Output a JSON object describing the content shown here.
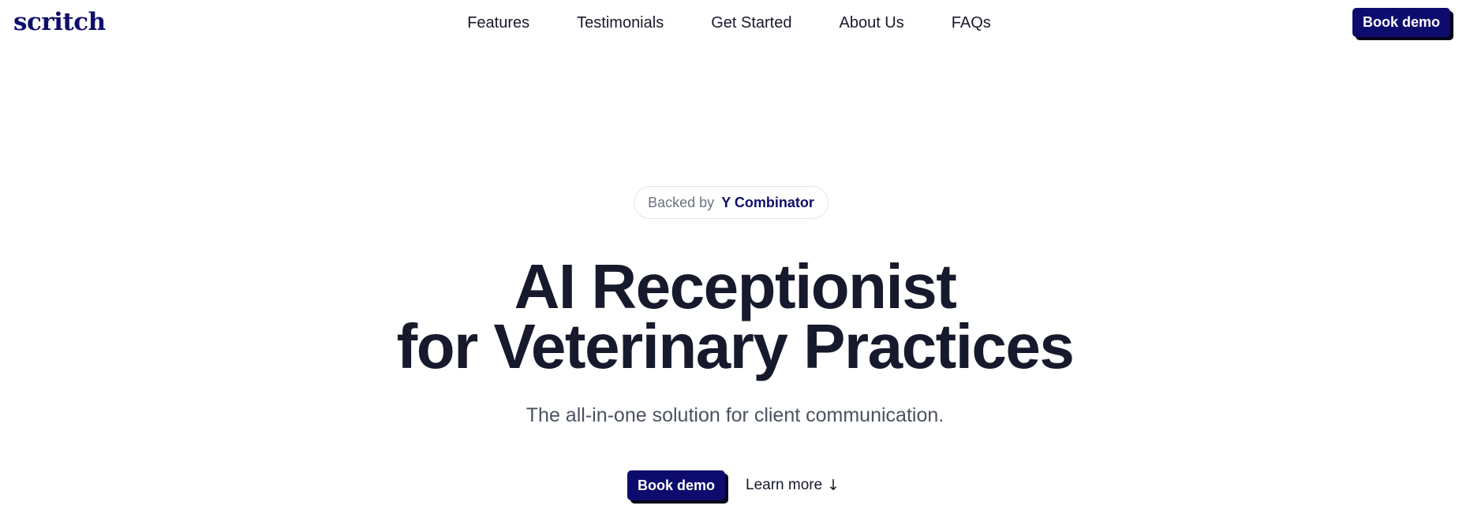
{
  "header": {
    "logo": "scritch",
    "nav": [
      "Features",
      "Testimonials",
      "Get Started",
      "About Us",
      "FAQs"
    ],
    "cta_label": "Book demo"
  },
  "hero": {
    "badge": {
      "prefix": "Backed by",
      "brand": "Y Combinator"
    },
    "headline_line1": "AI Receptionist",
    "headline_line2": "for Veterinary Practices",
    "subtitle": "The all-in-one solution for client communication.",
    "primary_cta": "Book demo",
    "secondary_cta": "Learn more",
    "secondary_icon": "↓"
  },
  "colors": {
    "brand": "#0d0c6e",
    "text": "#171a2c",
    "muted": "#6b7280",
    "background": "#ffffff"
  },
  "icons": {
    "learn_more_icon": "arrow-down-icon"
  }
}
